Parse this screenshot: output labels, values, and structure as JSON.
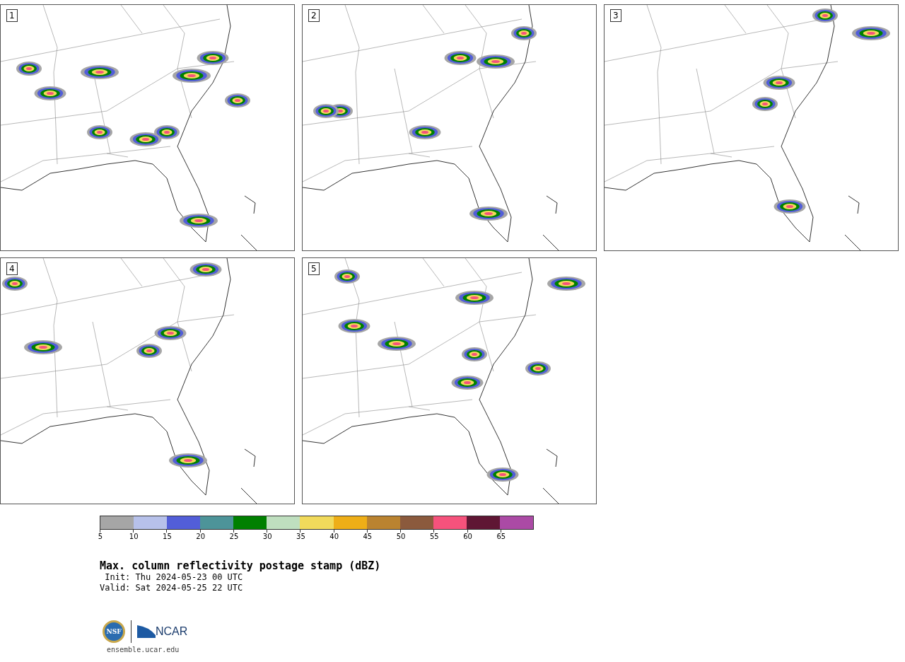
{
  "panels": [
    {
      "label": "1"
    },
    {
      "label": "2"
    },
    {
      "label": "3"
    },
    {
      "label": "4"
    },
    {
      "label": "5"
    }
  ],
  "colorbar": {
    "bins": [
      {
        "color": "#a6a6a6"
      },
      {
        "color": "#b7c1ea"
      },
      {
        "color": "#525ed8"
      },
      {
        "color": "#4d9499"
      },
      {
        "color": "#008000"
      },
      {
        "color": "#bfdfbf"
      },
      {
        "color": "#f1da5b"
      },
      {
        "color": "#eeae17"
      },
      {
        "color": "#ba8330"
      },
      {
        "color": "#8b5a3d"
      },
      {
        "color": "#f5527c"
      },
      {
        "color": "#5f1634"
      },
      {
        "color": "#ab4aa5"
      }
    ],
    "ticks": [
      "5",
      "10",
      "15",
      "20",
      "25",
      "30",
      "35",
      "40",
      "45",
      "50",
      "55",
      "60",
      "65"
    ]
  },
  "title": "Max. column reflectivity postage stamp (dBZ)",
  "init": " Init: Thu 2024-05-23 00 UTC",
  "valid": "Valid: Sat 2024-05-25 22 UTC",
  "logo": {
    "seal": "NSF",
    "wordmark": "NCAR"
  },
  "footer": "ensemble.ucar.edu"
}
